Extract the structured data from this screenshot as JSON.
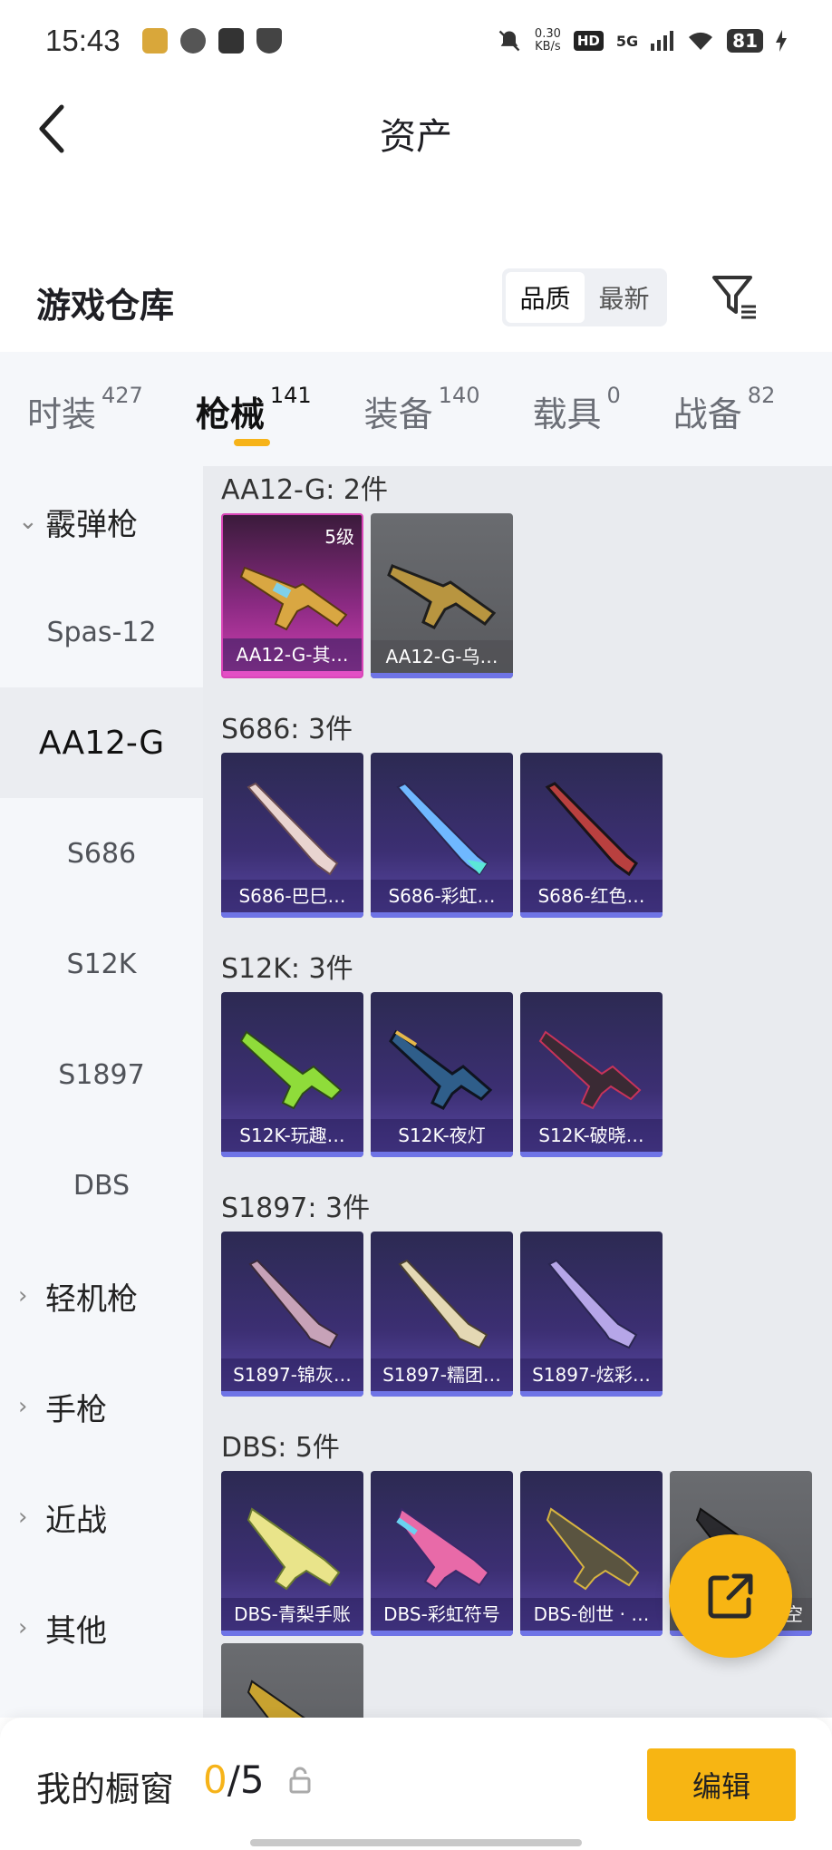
{
  "status_bar": {
    "time": "15:43",
    "net_speed_top": "0.30",
    "net_speed_bottom": "KB/s",
    "hd": "HD",
    "network": "5G",
    "battery": "81"
  },
  "header": {
    "title": "资产"
  },
  "section": {
    "title": "游戏仓库"
  },
  "sort": {
    "options": [
      "品质",
      "最新"
    ],
    "active": "品质"
  },
  "tabs": [
    {
      "label": "时装",
      "count": "427"
    },
    {
      "label": "枪械",
      "count": "141"
    },
    {
      "label": "装备",
      "count": "140"
    },
    {
      "label": "载具",
      "count": "0"
    },
    {
      "label": "战备",
      "count": "82"
    }
  ],
  "active_tab": "枪械",
  "sidebar": {
    "items": [
      {
        "label": "霰弹枪",
        "type": "group",
        "expanded": true
      },
      {
        "label": "Spas-12",
        "type": "sub"
      },
      {
        "label": "AA12-G",
        "type": "sub",
        "active": true
      },
      {
        "label": "S686",
        "type": "sub"
      },
      {
        "label": "S12K",
        "type": "sub"
      },
      {
        "label": "S1897",
        "type": "sub"
      },
      {
        "label": "DBS",
        "type": "sub"
      },
      {
        "label": "轻机枪",
        "type": "group"
      },
      {
        "label": "手枪",
        "type": "group"
      },
      {
        "label": "近战",
        "type": "group"
      },
      {
        "label": "其他",
        "type": "group"
      }
    ]
  },
  "groups": [
    {
      "title": "AA12-G: 2件",
      "cards": [
        {
          "name": "AA12-G-其…",
          "style": "pink",
          "level": "5级"
        },
        {
          "name": "AA12-G-乌…",
          "style": "gray"
        }
      ]
    },
    {
      "title": "S686: 3件",
      "cards": [
        {
          "name": "S686-巴巳…",
          "style": "purple"
        },
        {
          "name": "S686-彩虹…",
          "style": "purple"
        },
        {
          "name": "S686-红色…",
          "style": "purple"
        }
      ]
    },
    {
      "title": "S12K: 3件",
      "cards": [
        {
          "name": "S12K-玩趣…",
          "style": "purple"
        },
        {
          "name": "S12K-夜灯",
          "style": "purple"
        },
        {
          "name": "S12K-破晓…",
          "style": "purple"
        }
      ]
    },
    {
      "title": "S1897: 3件",
      "cards": [
        {
          "name": "S1897-锦灰…",
          "style": "purple"
        },
        {
          "name": "S1897-糯团…",
          "style": "purple"
        },
        {
          "name": "S1897-炫彩…",
          "style": "purple"
        }
      ]
    },
    {
      "title": "DBS: 5件",
      "cards": [
        {
          "name": "DBS-青梨手账",
          "style": "purple"
        },
        {
          "name": "DBS-彩虹符号",
          "style": "purple"
        },
        {
          "name": "DBS-创世 · …",
          "style": "purple"
        },
        {
          "name": "空",
          "style": "gray"
        },
        {
          "name": "",
          "style": "gray"
        }
      ]
    }
  ],
  "bottom_bar": {
    "title": "我的橱窗",
    "count_current": "0",
    "count_total": "/5",
    "edit_label": "编辑"
  },
  "colors": {
    "accent": "#f6b319",
    "card_purple": "#3c2f73",
    "card_pink": "#d340b4",
    "card_gray": "#5f6064"
  }
}
